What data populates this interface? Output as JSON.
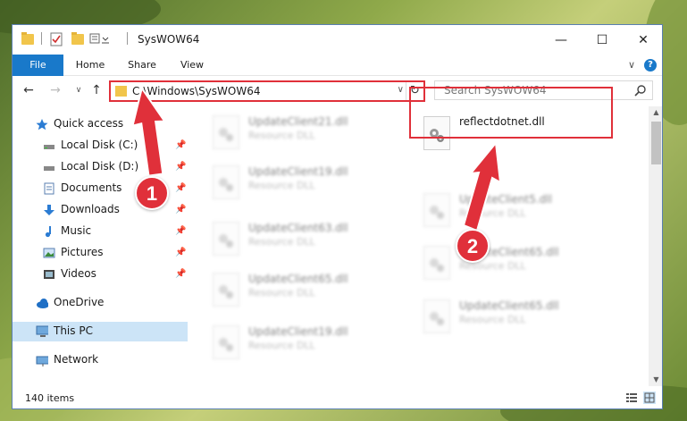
{
  "window": {
    "title": "SysWOW64",
    "minimize_label": "—",
    "maximize_label": "☐",
    "close_label": "✕"
  },
  "ribbon": {
    "tabs": [
      "File",
      "Home",
      "Share",
      "View"
    ],
    "expand_label": "∨",
    "help_label": "?"
  },
  "nav": {
    "back_label": "←",
    "forward_label": "→",
    "recent_label": "∨",
    "up_label": "↑"
  },
  "address": {
    "path": "C:\\Windows\\SysWOW64",
    "refresh_label": "↻",
    "dropdown_label": "∨"
  },
  "search": {
    "placeholder": "Search SysWOW64"
  },
  "sidebar": {
    "items": [
      {
        "label": "Quick access",
        "icon": "star-icon"
      },
      {
        "label": "Local Disk (C:)",
        "icon": "drive-icon",
        "pinned": true
      },
      {
        "label": "Local Disk (D:)",
        "icon": "drive-icon",
        "pinned": true
      },
      {
        "label": "Documents",
        "icon": "document-icon",
        "pinned": true
      },
      {
        "label": "Downloads",
        "icon": "download-icon",
        "pinned": true
      },
      {
        "label": "Music",
        "icon": "music-icon",
        "pinned": true
      },
      {
        "label": "Pictures",
        "icon": "picture-icon",
        "pinned": true
      },
      {
        "label": "Videos",
        "icon": "video-icon",
        "pinned": true
      },
      {
        "label": "OneDrive",
        "icon": "cloud-icon"
      },
      {
        "label": "This PC",
        "icon": "computer-icon",
        "selected": true
      },
      {
        "label": "Network",
        "icon": "network-icon"
      }
    ]
  },
  "files": {
    "left_column": [
      {
        "name": "UpdateClient21.dll",
        "type": "Resource DLL"
      },
      {
        "name": "UpdateClient19.dll",
        "type": "Resource DLL"
      },
      {
        "name": "UpdateClient63.dll",
        "type": "Resource DLL"
      },
      {
        "name": "UpdateClient65.dll",
        "type": "Resource DLL"
      },
      {
        "name": "UpdateClient19.dll",
        "type": "Resource DLL"
      }
    ],
    "right_column": [
      {
        "name": "reflectdotnet.dll",
        "type": ""
      },
      {
        "name": "UpdateClient5.dll",
        "type": "Resource DLL"
      },
      {
        "name": "UpdateClient65.dll",
        "type": "Resource DLL"
      },
      {
        "name": "UpdateClient65.dll",
        "type": "Resource DLL"
      }
    ]
  },
  "status": {
    "item_count": "140 items"
  },
  "annotations": {
    "step1": "1",
    "step2": "2",
    "color": "#e0303a"
  }
}
